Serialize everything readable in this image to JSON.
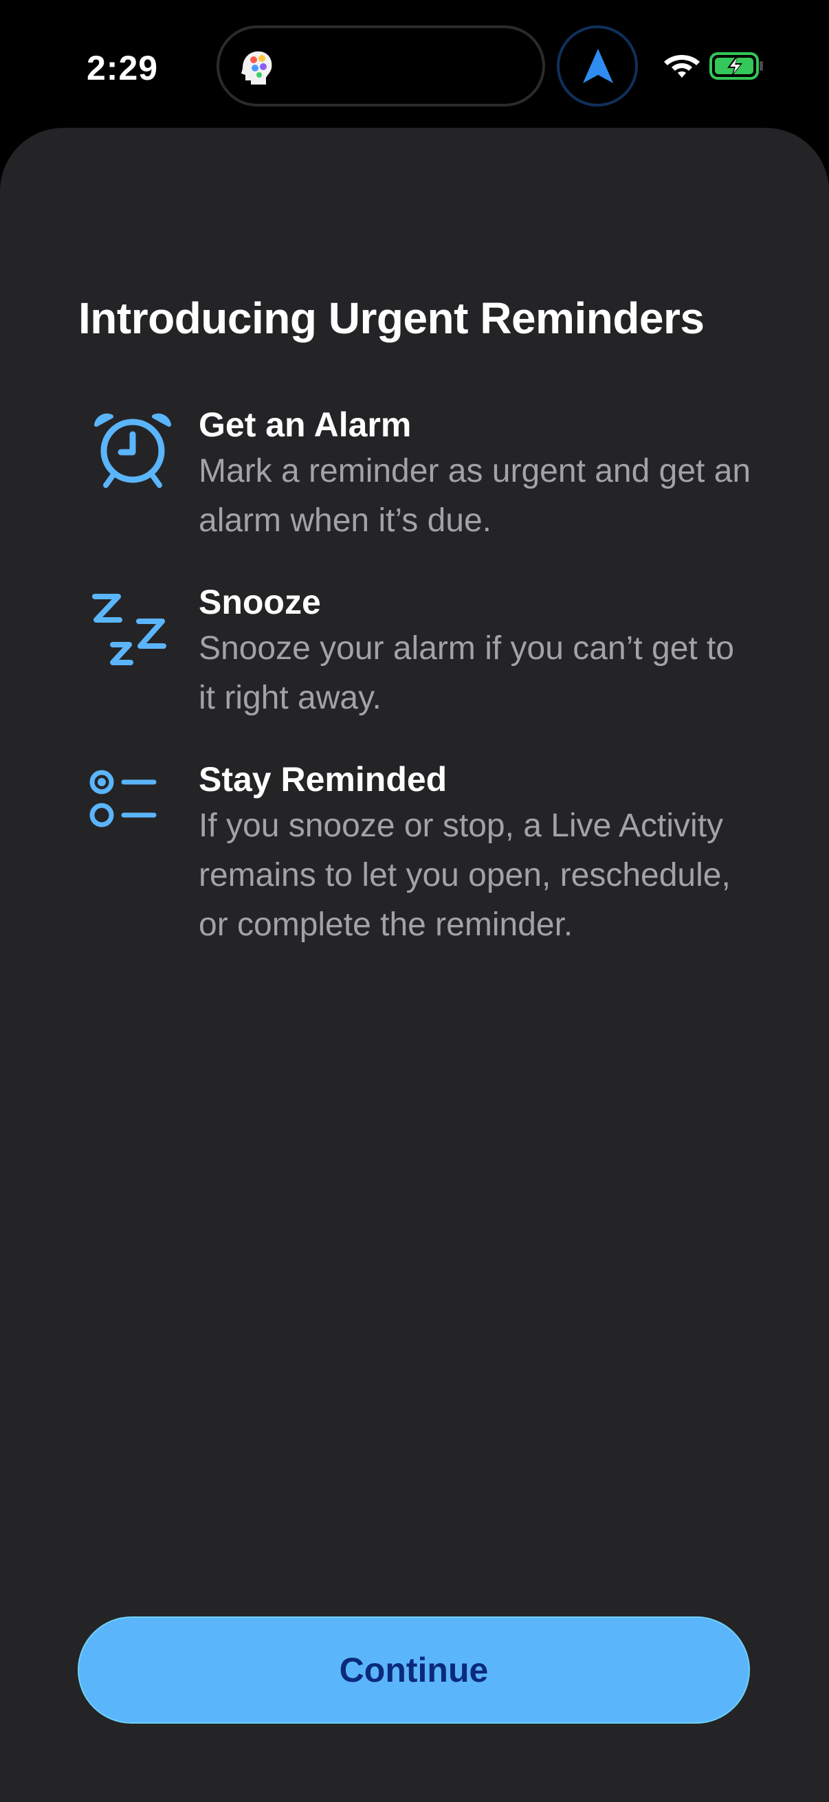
{
  "status_bar": {
    "time": "2:29",
    "island_app_icon": "brain-head-icon",
    "navigation_icon": "location-arrow-icon",
    "wifi_icon": "wifi-icon",
    "battery_icon": "battery-charging-icon"
  },
  "sheet": {
    "title": "Introducing Urgent Reminders",
    "features": [
      {
        "icon": "alarm-clock-icon",
        "title": "Get an Alarm",
        "description": "Mark a reminder as urgent and get an alarm when it’s due."
      },
      {
        "icon": "snooze-zzz-icon",
        "title": "Snooze",
        "description": "Snooze your alarm if you can’t get to it right away."
      },
      {
        "icon": "list-options-icon",
        "title": "Stay Reminded",
        "description": "If you snooze or stop, a Live Activity remains to let you open, reschedule, or complete the reminder."
      }
    ],
    "continue_label": "Continue"
  },
  "colors": {
    "accent": "#5bb5fb",
    "sheet_background": "#242426",
    "secondary_text": "#a2a2a8",
    "button_text": "#0a2a7a",
    "battery_green": "#34c759"
  }
}
